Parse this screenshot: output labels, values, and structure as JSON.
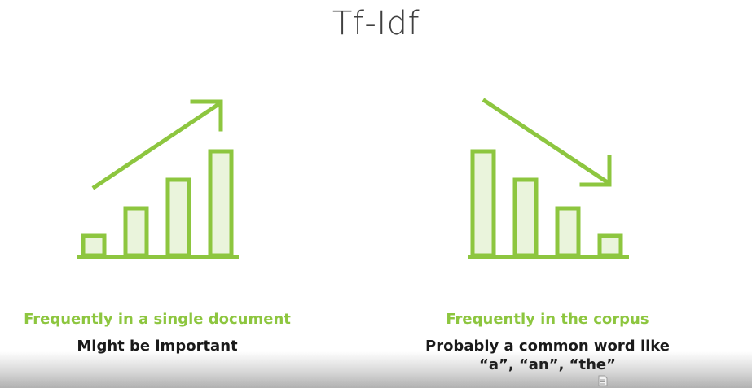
{
  "slide": {
    "title": "Tf-Idf"
  },
  "left_panel": {
    "heading": "Frequently in a single document",
    "description": "Might be important",
    "icon": "bar-chart-increasing-icon",
    "trend": "increasing",
    "bar_levels": [
      1,
      2,
      3,
      4
    ]
  },
  "right_panel": {
    "heading": "Frequently in the corpus",
    "description_line1": "Probably a common word like",
    "description_line2": "“a”, “an”, “the”",
    "icon": "bar-chart-decreasing-icon",
    "trend": "decreasing",
    "bar_levels": [
      4,
      3,
      2,
      1
    ]
  },
  "colors": {
    "accent_green": "#8dc63f",
    "bar_fill": "#eaf4dc",
    "title_text": "#404040",
    "body_text": "#1a1a1a"
  },
  "overlay": {
    "icon": "document-icon"
  }
}
